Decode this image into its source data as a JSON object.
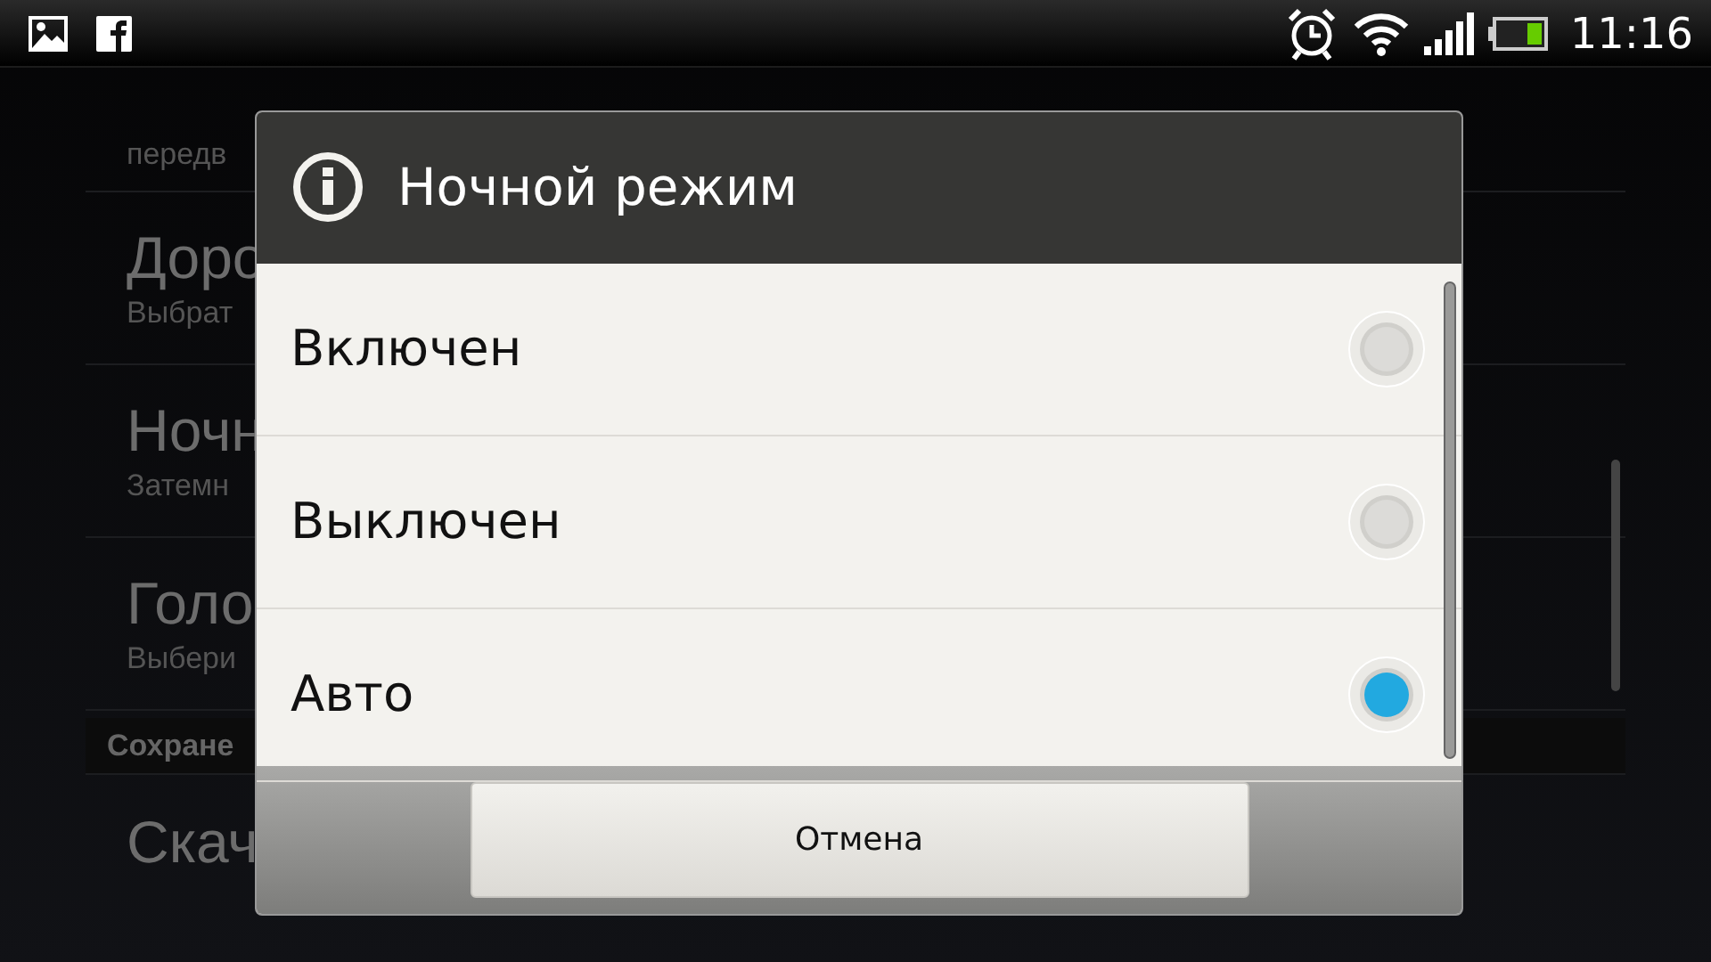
{
  "status_bar": {
    "time": "11:16"
  },
  "settings_list": [
    {
      "kind": "partial",
      "subtitle": "передв"
    },
    {
      "kind": "item",
      "title": "Доро",
      "subtitle": "Выбрат"
    },
    {
      "kind": "item",
      "title": "Ночн",
      "subtitle": "Затемн"
    },
    {
      "kind": "item",
      "title": "Голо",
      "subtitle": "Выбери"
    },
    {
      "kind": "header",
      "title": "Сохране"
    },
    {
      "kind": "item",
      "title": "Скач"
    }
  ],
  "dialog": {
    "title": "Ночной режим",
    "options": [
      {
        "label": "Включен",
        "selected": false
      },
      {
        "label": "Выключен",
        "selected": false
      },
      {
        "label": "Авто",
        "selected": true
      }
    ],
    "cancel_button": "Отмена"
  }
}
